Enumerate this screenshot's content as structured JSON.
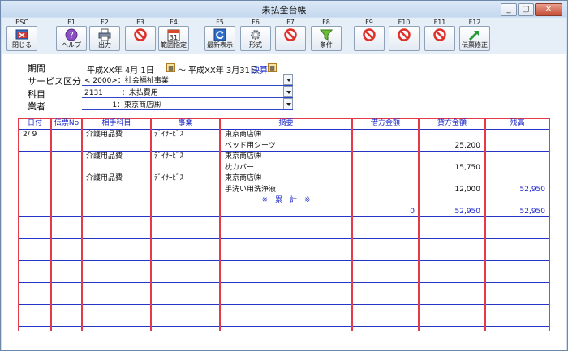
{
  "window": {
    "title": "未払金台帳",
    "minimize": "_",
    "restore": "▢",
    "close": "✕"
  },
  "toolbar": {
    "buttons": [
      {
        "key": "ESC",
        "label": "閉じる"
      },
      {
        "key": "F1",
        "label": "ヘルプ"
      },
      {
        "key": "F2",
        "label": "出力"
      },
      {
        "key": "F3",
        "label": ""
      },
      {
        "key": "F4",
        "label": "範囲指定"
      },
      {
        "key": "F5",
        "label": "最新表示"
      },
      {
        "key": "F6",
        "label": "形式"
      },
      {
        "key": "F7",
        "label": ""
      },
      {
        "key": "F8",
        "label": "条件"
      },
      {
        "key": "F9",
        "label": ""
      },
      {
        "key": "F10",
        "label": ""
      },
      {
        "key": "F11",
        "label": ""
      },
      {
        "key": "F12",
        "label": "伝票修正"
      }
    ],
    "icons": [
      "close-window-icon",
      "help-icon",
      "print-icon",
      "prohibited-icon",
      "calendar-icon",
      "refresh-icon",
      "gear-icon",
      "prohibited-icon",
      "filter-icon",
      "prohibited-icon",
      "prohibited-icon",
      "prohibited-icon",
      "arrow-up-right-icon"
    ],
    "calendar_number": "31"
  },
  "filters": {
    "period_label": "期間",
    "period_start": "平成XX年  4月 1日",
    "period_tilde": "～",
    "period_end": "平成XX年  3月31日",
    "closing_label": "決算",
    "service_label": "サービス区分",
    "service_value": "< 2000>：社会福祉事業",
    "account_label": "科目",
    "account_value": "2131        ：未払費用",
    "vendor_label": "業者",
    "vendor_value": "            1：東京商店㈱"
  },
  "ledger": {
    "headers": [
      "日付",
      "伝票No",
      "相手科目",
      "事業",
      "摘要",
      "借方金額",
      "貸方金額",
      "残高"
    ],
    "rows": [
      {
        "date": "2/ 9",
        "slip": "",
        "account": "介護用品費",
        "business": "ﾃﾞｲｻｰﾋﾞｽ",
        "memo1": "東京商店㈱",
        "memo2": "ベッド用シーツ",
        "debit": "",
        "credit": "25,200",
        "balance": ""
      },
      {
        "date": "",
        "slip": "",
        "account": "介護用品費",
        "business": "ﾃﾞｲｻｰﾋﾞｽ",
        "memo1": "東京商店㈱",
        "memo2": "枕カバー",
        "debit": "",
        "credit": "15,750",
        "balance": ""
      },
      {
        "date": "",
        "slip": "",
        "account": "介護用品費",
        "business": "ﾃﾞｲｻｰﾋﾞｽ",
        "memo1": "東京商店㈱",
        "memo2": "手洗い用洗浄液",
        "debit": "",
        "credit": "12,000",
        "balance": "52,950"
      }
    ],
    "total": {
      "label": "※　累　計　※",
      "debit": "0",
      "credit": "52,950",
      "balance": "52,950"
    }
  },
  "colors": {
    "grid_red": "#e63a4a",
    "grid_blue": "#2535c8",
    "header_text": "#1c28c8"
  }
}
